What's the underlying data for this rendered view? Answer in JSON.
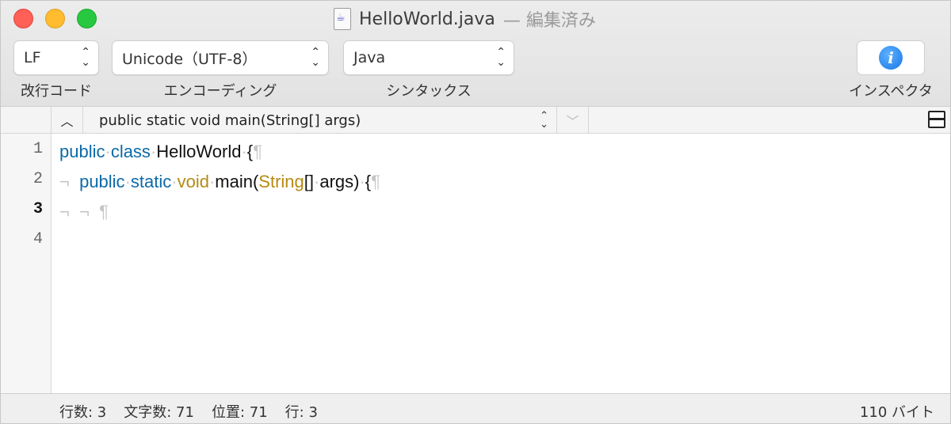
{
  "window": {
    "file_name": "HelloWorld.java",
    "status": "— 編集済み"
  },
  "toolbar": {
    "line_ending": {
      "value": "LF",
      "label": "改行コード"
    },
    "encoding": {
      "value": "Unicode（UTF-8）",
      "label": "エンコーディング"
    },
    "syntax": {
      "value": "Java",
      "label": "シンタックス"
    },
    "inspector": {
      "label": "インスペクタ",
      "icon": "info-icon"
    }
  },
  "navbar": {
    "function": "public static void main(String[] args)"
  },
  "editor": {
    "line_numbers": [
      "1",
      "2",
      "3",
      "4"
    ],
    "current_line": 3,
    "lines": [
      {
        "tokens": [
          {
            "t": "public",
            "c": "kw"
          },
          {
            "t": "·",
            "c": "inv"
          },
          {
            "t": "class",
            "c": "kw"
          },
          {
            "t": "·",
            "c": "inv"
          },
          {
            "t": "HelloWorld",
            "c": ""
          },
          {
            "t": "·",
            "c": "inv"
          },
          {
            "t": "{",
            "c": ""
          },
          {
            "t": "¶",
            "c": "inv"
          }
        ]
      },
      {
        "tokens": [
          {
            "t": "¬  ",
            "c": "inv"
          },
          {
            "t": "public",
            "c": "kw"
          },
          {
            "t": "·",
            "c": "inv"
          },
          {
            "t": "static",
            "c": "kw"
          },
          {
            "t": "·",
            "c": "inv"
          },
          {
            "t": "void",
            "c": "ty"
          },
          {
            "t": "·",
            "c": "inv"
          },
          {
            "t": "main(",
            "c": ""
          },
          {
            "t": "String",
            "c": "ty"
          },
          {
            "t": "[]",
            "c": ""
          },
          {
            "t": "·",
            "c": "inv"
          },
          {
            "t": "args)",
            "c": ""
          },
          {
            "t": "·",
            "c": "inv"
          },
          {
            "t": "{",
            "c": ""
          },
          {
            "t": "¶",
            "c": "inv"
          }
        ]
      },
      {
        "tokens": [
          {
            "t": "¬  ¬  ¶",
            "c": "inv"
          }
        ]
      },
      {
        "tokens": []
      }
    ]
  },
  "statusbar": {
    "lines": "行数: 3",
    "chars": "文字数: 71",
    "position": "位置: 71",
    "row": "行: 3",
    "size": "110 バイト"
  },
  "colors": {
    "keyword": "#0c6aa8",
    "type": "#b58a14",
    "invisible": "#c6c6c6"
  }
}
